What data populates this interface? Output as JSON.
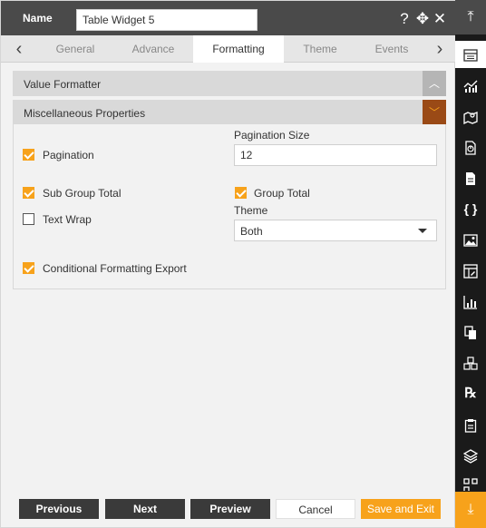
{
  "header": {
    "name_label": "Name",
    "name_value": "Table Widget 5",
    "help_icon": "?",
    "move_icon": "✥",
    "close_icon": "✕"
  },
  "tabs": {
    "prev_arrow": "‹",
    "next_arrow": "›",
    "items": [
      {
        "label": "General"
      },
      {
        "label": "Advance"
      },
      {
        "label": "Formatting",
        "active": true
      },
      {
        "label": "Theme"
      },
      {
        "label": "Events"
      }
    ]
  },
  "sections": {
    "value_formatter": {
      "title": "Value Formatter",
      "toggle": "︿"
    },
    "misc": {
      "title": "Miscellaneous Properties",
      "toggle": "﹀"
    }
  },
  "misc": {
    "pagination": {
      "label": "Pagination",
      "checked": true
    },
    "pagination_size": {
      "label": "Pagination Size",
      "value": "12"
    },
    "sub_group_total": {
      "label": "Sub Group Total",
      "checked": true
    },
    "group_total": {
      "label": "Group Total",
      "checked": true
    },
    "text_wrap": {
      "label": "Text Wrap",
      "checked": false
    },
    "theme": {
      "label": "Theme",
      "value": "Both"
    },
    "conditional_export": {
      "label": "Conditional Formatting Export",
      "checked": true
    }
  },
  "footer": {
    "previous": "Previous",
    "next": "Next",
    "preview": "Preview",
    "cancel": "Cancel",
    "save_exit": "Save and Exit"
  },
  "iconbar": {
    "top": "⤒",
    "bottom": "⤓",
    "icons": [
      "table-icon",
      "chart-icon",
      "map-icon",
      "report-icon",
      "document-icon",
      "code-braces-icon",
      "image-icon",
      "form-icon",
      "bar-chart-icon",
      "copy-icon",
      "cubes-icon",
      "rx-icon",
      "clipboard-icon",
      "layers-icon",
      "grid-icon"
    ]
  },
  "colors": {
    "accent": "#f7a21b",
    "header_bg": "#4a4a4a",
    "sidebar_bg": "#1a1a1a"
  }
}
